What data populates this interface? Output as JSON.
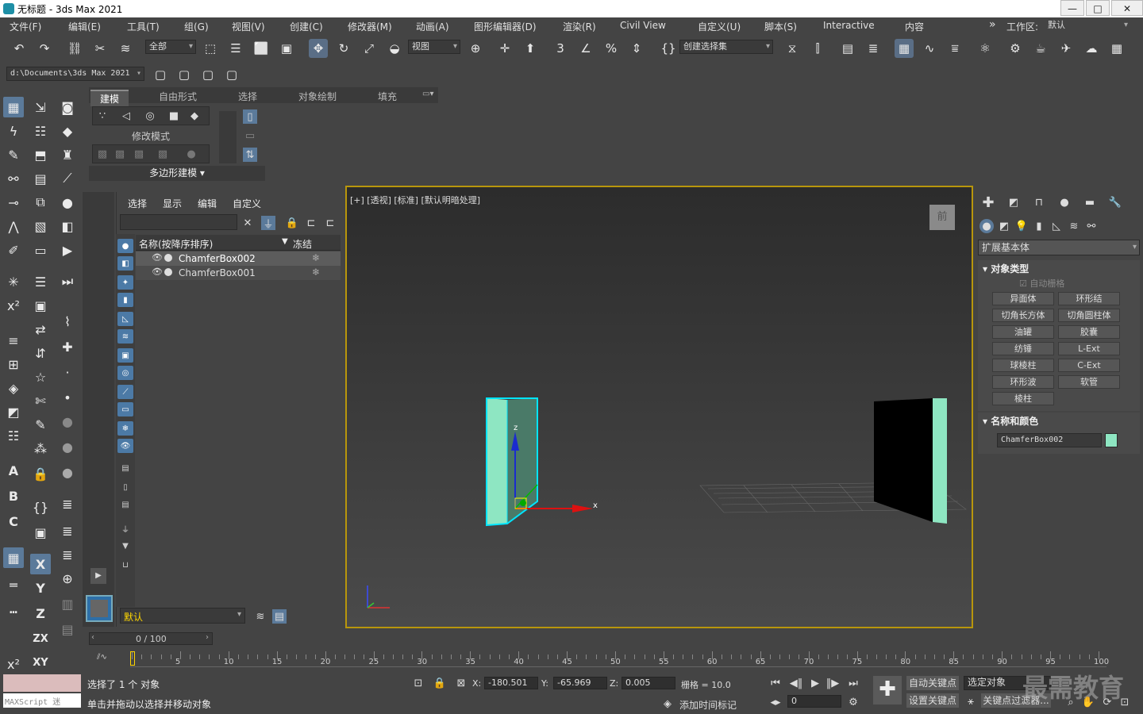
{
  "window": {
    "title": "无标题 - 3ds Max 2021",
    "min": "—",
    "max": "□",
    "close": "✕"
  },
  "menu": [
    "文件(F)",
    "编辑(E)",
    "工具(T)",
    "组(G)",
    "视图(V)",
    "创建(C)",
    "修改器(M)",
    "动画(A)",
    "图形编辑器(D)",
    "渲染(R)",
    "Civil View",
    "自定义(U)",
    "脚本(S)",
    "Interactive",
    "内容"
  ],
  "workspace": {
    "label": "工作区:",
    "value": "默认",
    "expand": "»"
  },
  "toolbar": {
    "filter_value": "全部",
    "ref_coord": "视图",
    "selection_set": "创建选择集"
  },
  "project_path": "d:\\Documents\\3ds Max 2021",
  "ribbon": {
    "tabs": [
      "建模",
      "自由形式",
      "选择",
      "对象绘制",
      "填充"
    ],
    "active_tab": "建模",
    "modify_mode": "修改模式",
    "poly_modeling": "多边形建模"
  },
  "explorer": {
    "menu": [
      "选择",
      "显示",
      "编辑",
      "自定义"
    ],
    "col_name": "名称(按降序排序)",
    "col_freeze": "冻结",
    "rows": [
      {
        "name": "ChamferBox002",
        "selected": true
      },
      {
        "name": "ChamferBox001",
        "selected": false
      }
    ],
    "layer": "默认"
  },
  "viewport": {
    "label": "[+] [透视] [标准] [默认明暗处理]",
    "viewcube": "前",
    "axis_x": "x",
    "axis_y": "y",
    "axis_z": "z"
  },
  "cmdpanel": {
    "category": "扩展基本体",
    "section_type": "对象类型",
    "autogrid": "自动栅格",
    "buttons": [
      "异面体",
      "环形结",
      "切角长方体",
      "切角圆柱体",
      "油罐",
      "胶囊",
      "纺锤",
      "L-Ext",
      "球棱柱",
      "C-Ext",
      "环形波",
      "软管",
      "棱柱"
    ],
    "section_name": "名称和颜色",
    "object_name": "ChamferBox002",
    "object_color": "#8ee6c2"
  },
  "timeline": {
    "frame_display": "0 / 100",
    "ticks": [
      "5",
      "10",
      "15",
      "20",
      "25",
      "30",
      "35",
      "40",
      "45",
      "50",
      "55",
      "60",
      "65",
      "70",
      "75",
      "80",
      "85",
      "90",
      "95",
      "100"
    ]
  },
  "status": {
    "selected": "选择了 1 个 对象",
    "hint": "单击并拖动以选择并移动对象",
    "maxscript": "MAXScript 迷",
    "x_label": "X:",
    "x": "-180.501",
    "y_label": "Y:",
    "y": "-65.969",
    "z_label": "Z:",
    "z": "0.005",
    "grid": "栅格 = 10.0",
    "add_time_tag": "添加时间标记",
    "auto_key": "自动关键点",
    "selected_obj": "选定对象",
    "set_key": "设置关键点",
    "key_filter": "关键点过滤器...",
    "frame": "0",
    "watermark": "最需教育"
  }
}
